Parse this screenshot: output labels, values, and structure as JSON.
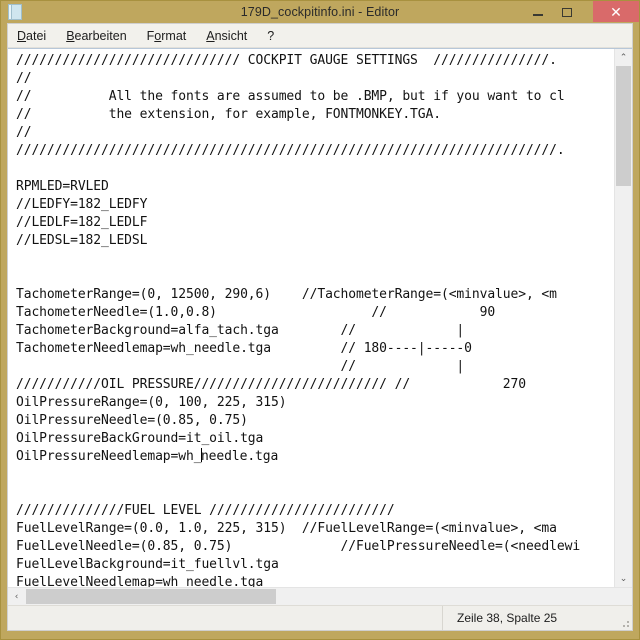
{
  "window": {
    "title": "179D_cockpitinfo.ini - Editor",
    "icon": "notepad-document-icon",
    "titlebar_color": "#bfa75e",
    "close_button_color": "#d96a6a",
    "controls": {
      "minimize": "minimize-icon",
      "maximize": "maximize-icon",
      "close": "✕"
    }
  },
  "menu": {
    "items": [
      {
        "label": "Datei",
        "mnemonic": "D"
      },
      {
        "label": "Bearbeiten",
        "mnemonic": "B"
      },
      {
        "label": "Format",
        "mnemonic": "o"
      },
      {
        "label": "Ansicht",
        "mnemonic": "A"
      },
      {
        "label": "?",
        "mnemonic": ""
      }
    ]
  },
  "editor": {
    "lines": [
      "///////////////////////////// COCKPIT GAUGE SETTINGS  ///////////////.",
      "//",
      "//          All the fonts are assumed to be .BMP, but if you want to cl",
      "//          the extension, for example, FONTMONKEY.TGA.",
      "//",
      "//////////////////////////////////////////////////////////////////////.",
      "",
      "RPMLED=RVLED",
      "//LEDFY=182_LEDFY",
      "//LEDLF=182_LEDLF",
      "//LEDSL=182_LEDSL",
      "",
      "",
      "TachometerRange=(0, 12500, 290,6)    //TachometerRange=(<minvalue>, <m",
      "TachometerNeedle=(1.0,0.8)                    //            90",
      "TachometerBackground=alfa_tach.tga        //             |",
      "TachometerNeedlemap=wh_needle.tga         // 180----|-----0",
      "                                          //             |",
      "///////////OIL PRESSURE///////////////////////// //            270",
      "OilPressureRange=(0, 100, 225, 315)",
      "OilPressureNeedle=(0.85, 0.75)",
      "OilPressureBackGround=it_oil.tga",
      "",
      "",
      "//////////////FUEL LEVEL ////////////////////////",
      "FuelLevelRange=(0.0, 1.0, 225, 315)  //FuelLevelRange=(<minvalue>, <ma",
      "FuelLevelNeedle=(0.85, 0.75)              //FuelPressureNeedle=(<needlewi",
      "FuelLevelBackground=it_fuellvl.tga",
      "FuelLevelNeedlemap=wh_needle.tga"
    ],
    "caret_line": {
      "before": "OilPressureNeedlemap=wh_",
      "after": "needle.tga"
    }
  },
  "scrollbars": {
    "vertical": {
      "up_arrow": "⌃",
      "down_arrow": "⌄"
    },
    "horizontal": {
      "left_arrow": "‹",
      "right_arrow": "›"
    }
  },
  "statusbar": {
    "position": "Zeile 38, Spalte 25"
  }
}
